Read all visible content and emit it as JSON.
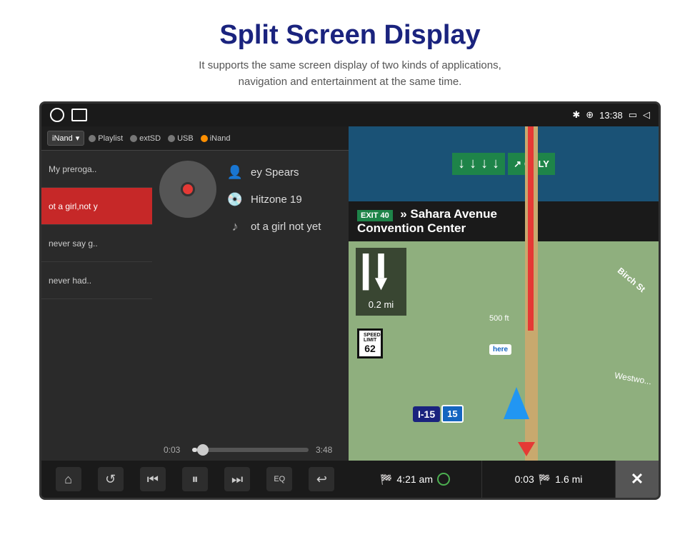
{
  "header": {
    "title": "Split Screen Display",
    "subtitle": "It supports the same screen display of two kinds of applications,\nnavigation and entertainment at the same time."
  },
  "status_bar": {
    "time": "13:38",
    "bluetooth": "✱",
    "location": "⊕"
  },
  "music": {
    "source_label": "iNand",
    "sources": [
      "Playlist",
      "extSD",
      "USB",
      "iNand"
    ],
    "playlist": [
      {
        "label": "My preroga..",
        "active": false
      },
      {
        "label": "ot a girl,not y",
        "active": true
      },
      {
        "label": "never say g..",
        "active": false
      },
      {
        "label": "never had..",
        "active": false
      }
    ],
    "artist": "ey Spears",
    "album": "Hitzone 19",
    "track": "ot a girl not yet",
    "time_current": "0:03",
    "time_total": "3:48",
    "controls": {
      "home": "⌂",
      "repeat": "↺",
      "prev": "⏮",
      "pause": "⏸",
      "next": "⏭",
      "eq": "EQ",
      "back": "↩"
    }
  },
  "navigation": {
    "exit_number": "EXIT 40",
    "direction_text": "» Sahara Avenue Convention Center",
    "distance_to_turn": "0.2 mi",
    "speed_limit": "62",
    "highway": "I-15",
    "route_number": "15",
    "ft_label": "500 ft",
    "street_birch": "Birch St",
    "street_westwood": "Westwo...",
    "eta": "4:21 am",
    "elapsed": "0:03",
    "remaining": "1.6 mi",
    "only_label": "ONLY"
  }
}
